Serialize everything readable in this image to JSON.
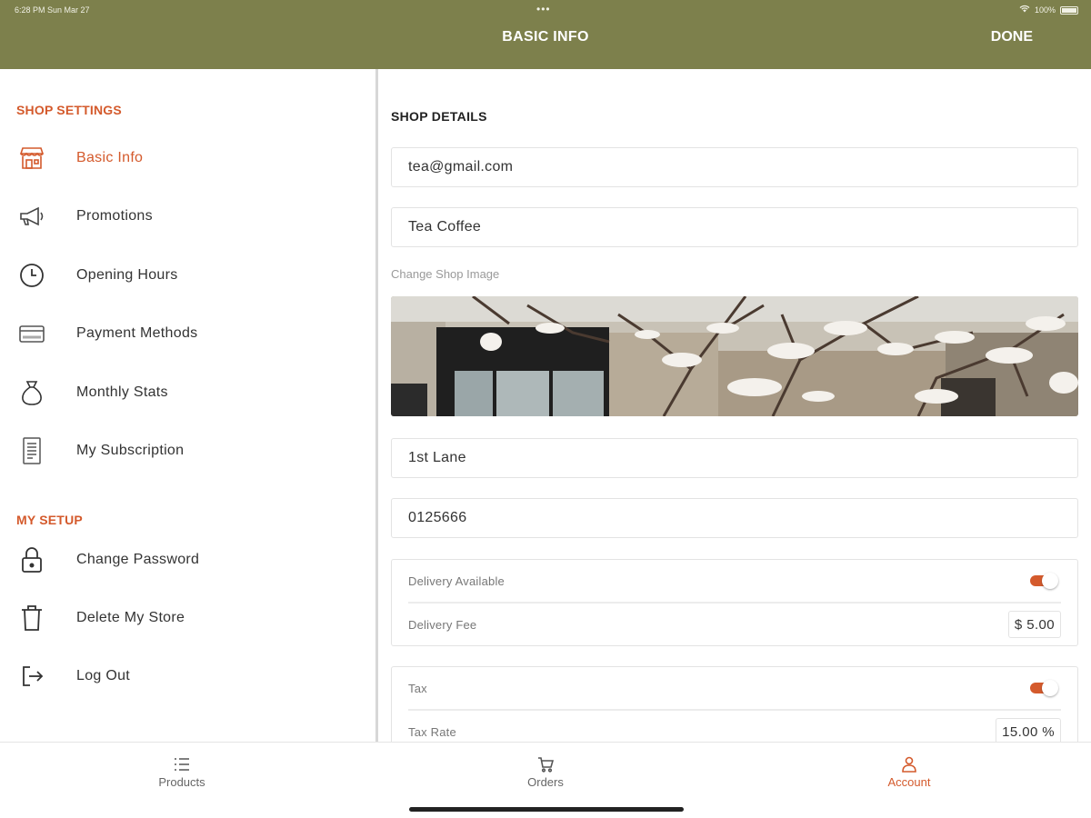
{
  "status_bar": {
    "time": "6:28 PM   Sun Mar 27",
    "dots": "•••",
    "battery": "100%"
  },
  "header": {
    "title": "BASIC INFO",
    "done_label": "DONE"
  },
  "sidebar": {
    "shop_settings_header": "SHOP SETTINGS",
    "shop_settings_items": [
      {
        "label": "Basic Info",
        "icon": "storefront-icon"
      },
      {
        "label": "Promotions",
        "icon": "megaphone-icon"
      },
      {
        "label": "Opening Hours",
        "icon": "clock-icon"
      },
      {
        "label": "Payment Methods",
        "icon": "credit-card-icon"
      },
      {
        "label": "Monthly Stats",
        "icon": "money-bag-icon"
      },
      {
        "label": "My Subscription",
        "icon": "document-icon"
      }
    ],
    "my_setup_header": "MY SETUP",
    "my_setup_items": [
      {
        "label": "Change Password",
        "icon": "lock-icon"
      },
      {
        "label": "Delete My Store",
        "icon": "trash-icon"
      },
      {
        "label": "Log Out",
        "icon": "logout-icon"
      }
    ]
  },
  "main": {
    "section_title": "SHOP DETAILS",
    "email_value": "tea@gmail.com",
    "shop_name_value": "Tea Coffee",
    "change_image_label": "Change Shop Image",
    "address_value": "1st Lane",
    "phone_value": "0125666",
    "delivery": {
      "available_label": "Delivery Available",
      "available_on": true,
      "fee_label": "Delivery Fee",
      "fee_value": "$  5.00"
    },
    "tax": {
      "label": "Tax",
      "on": true,
      "rate_label": "Tax Rate",
      "rate_value": "15.00 %"
    }
  },
  "tabbar": {
    "tabs": [
      {
        "label": "Products",
        "icon": "list-icon"
      },
      {
        "label": "Orders",
        "icon": "cart-icon"
      },
      {
        "label": "Account",
        "icon": "person-icon",
        "active": true
      }
    ]
  },
  "colors": {
    "header_bg": "#7d804c",
    "accent": "#d45a2c"
  }
}
